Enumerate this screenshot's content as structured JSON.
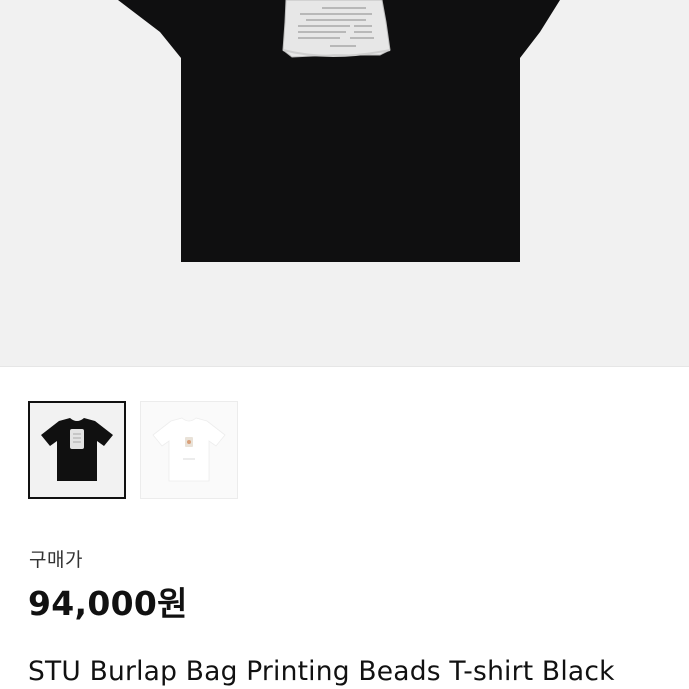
{
  "product": {
    "main_image_alt": "black t-shirt with burlap bag print",
    "thumbnails": [
      {
        "name": "thumbnail-black",
        "color": "#111111",
        "selected": true
      },
      {
        "name": "thumbnail-white",
        "color": "#ffffff",
        "selected": false
      }
    ],
    "price_label": "구매가",
    "price": "94,000원",
    "title": "STU Burlap Bag Printing Beads T-shirt Black"
  },
  "colors": {
    "hero_background": "#f1f1f1",
    "shirt_black": "#0f0f10",
    "bag_grey": "#e6e6e6"
  }
}
